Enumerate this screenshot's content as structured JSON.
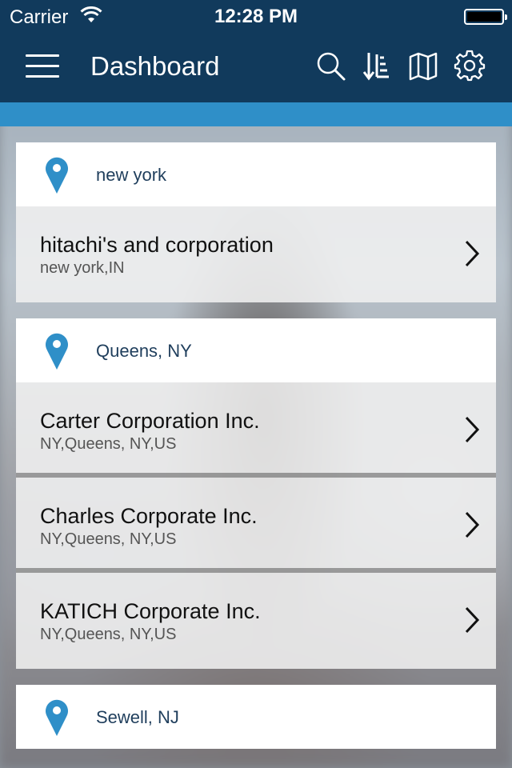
{
  "status_bar": {
    "carrier": "Carrier",
    "time": "12:28 PM"
  },
  "toolbar": {
    "title": "Dashboard",
    "icons": [
      "menu-icon",
      "search-icon",
      "sort-icon",
      "map-icon",
      "gear-icon"
    ]
  },
  "colors": {
    "nav_bg": "#113a5c",
    "accent": "#2f8fc8",
    "pin": "#2f8fc8"
  },
  "sections": [
    {
      "location": "new york",
      "items": [
        {
          "name": "hitachi's and corporation",
          "address": "new york,IN"
        }
      ]
    },
    {
      "location": "Queens, NY",
      "items": [
        {
          "name": "Carter Corporation Inc.",
          "address": "NY,Queens, NY,US"
        },
        {
          "name": "Charles Corporate Inc.",
          "address": "NY,Queens, NY,US"
        },
        {
          "name": "KATICH Corporate Inc.",
          "address": "NY,Queens, NY,US"
        }
      ]
    },
    {
      "location": "Sewell, NJ",
      "items": []
    }
  ]
}
